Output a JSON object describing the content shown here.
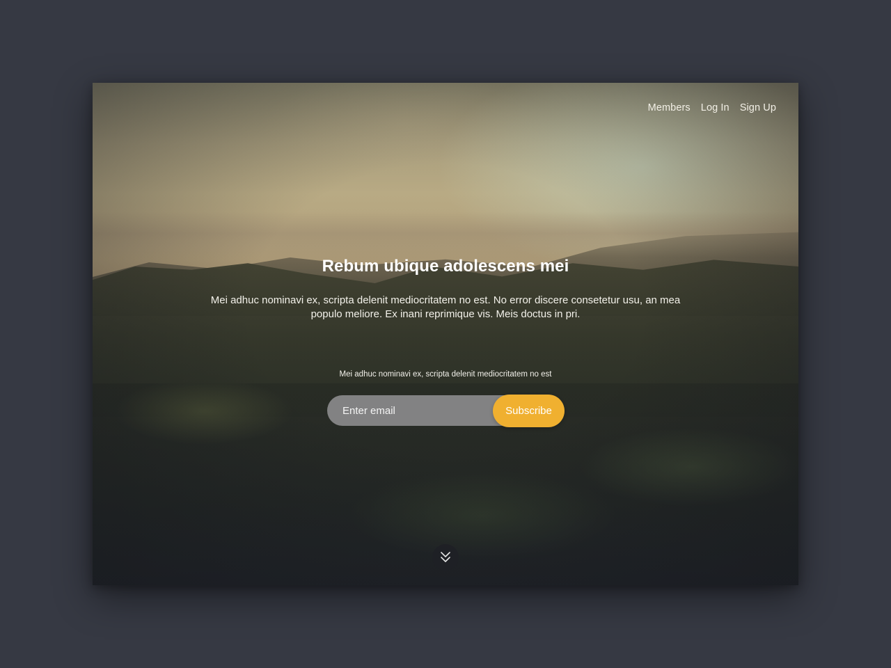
{
  "nav": {
    "items": [
      {
        "label": "Members"
      },
      {
        "label": "Log In"
      },
      {
        "label": "Sign Up"
      }
    ]
  },
  "hero": {
    "title": "Rebum ubique adolescens mei",
    "text": "Mei adhuc nominavi ex, scripta delenit mediocritatem no est. No error discere consetetur usu, an mea populo meliore. Ex inani reprimique vis. Meis doctus in pri."
  },
  "subscribe": {
    "caption": "Mei adhuc nominavi ex, scripta delenit mediocritatem no est",
    "email_placeholder": "Enter email",
    "email_value": "",
    "button_label": "Subscribe"
  },
  "scroll": {
    "icon": "double-chevron-down-icon"
  },
  "colors": {
    "page_background": "#363943",
    "accent": "#f0b030",
    "input_background": "#969698",
    "text": "#ffffff"
  }
}
